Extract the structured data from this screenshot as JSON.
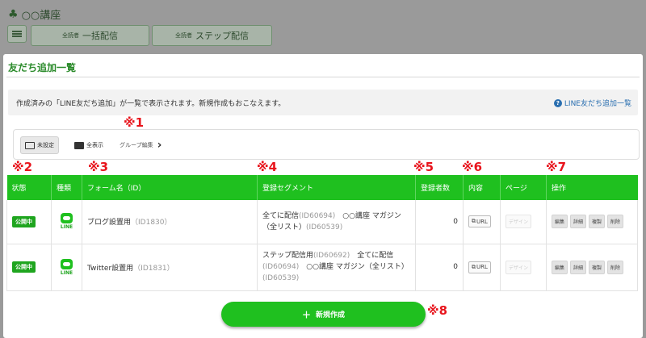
{
  "app": {
    "title": "○○講座"
  },
  "header": {
    "tab1": {
      "small": "全読者",
      "label": "一括配信"
    },
    "tab2": {
      "small": "全読者",
      "label": "ステップ配信"
    }
  },
  "page": {
    "title": "友だち追加一覧",
    "info_text": "作成済みの「LINE友だち追加」が一覧で表示されます。新規作成もおこなえます。",
    "help_link": "LINE友だち追加一覧"
  },
  "filters": {
    "unset": "未設定",
    "all": "全表示",
    "group_edit": "グループ編集"
  },
  "annotations": [
    "※1",
    "※2",
    "※3",
    "※4",
    "※5",
    "※6",
    "※7",
    "※8"
  ],
  "table": {
    "headers": [
      "状態",
      "種類",
      "フォーム名（ID）",
      "登録セグメント",
      "登録者数",
      "内容",
      "ページ",
      "操作"
    ],
    "rows": [
      {
        "status": "公開中",
        "type": "LINE",
        "name": "ブログ設置用",
        "name_id": "（ID1830）",
        "segment_parts": [
          {
            "t": "全てに配信",
            "c": "n"
          },
          {
            "t": "(ID60694)",
            "c": "g"
          },
          {
            "t": "　○○講座 マガジン（全リスト）",
            "c": "n"
          },
          {
            "t": "(ID60539)",
            "c": "g"
          }
        ],
        "count": "0",
        "url": "URL",
        "design": "デザイン",
        "ops": [
          "編集",
          "詳細",
          "複製",
          "削除"
        ]
      },
      {
        "status": "公開中",
        "type": "LINE",
        "name": "Twitter設置用",
        "name_id": "（ID1831）",
        "segment_parts": [
          {
            "t": "ステップ配信用",
            "c": "n"
          },
          {
            "t": "(ID60692)",
            "c": "g"
          },
          {
            "t": "　全てに配信",
            "c": "n"
          },
          {
            "t": "(ID60694)",
            "c": "g"
          },
          {
            "t": "　○○講座 マガジン（全リスト）",
            "c": "n"
          },
          {
            "t": "(ID60539)",
            "c": "g"
          }
        ],
        "count": "0",
        "url": "URL",
        "design": "デザイン",
        "ops": [
          "編集",
          "詳細",
          "複製",
          "削除"
        ]
      }
    ]
  },
  "create_button": {
    "label": "新規作成"
  },
  "colors": {
    "brand_green": "#1fc01f",
    "annotation_red": "#e8141c",
    "link_blue": "#2a6fb0"
  }
}
